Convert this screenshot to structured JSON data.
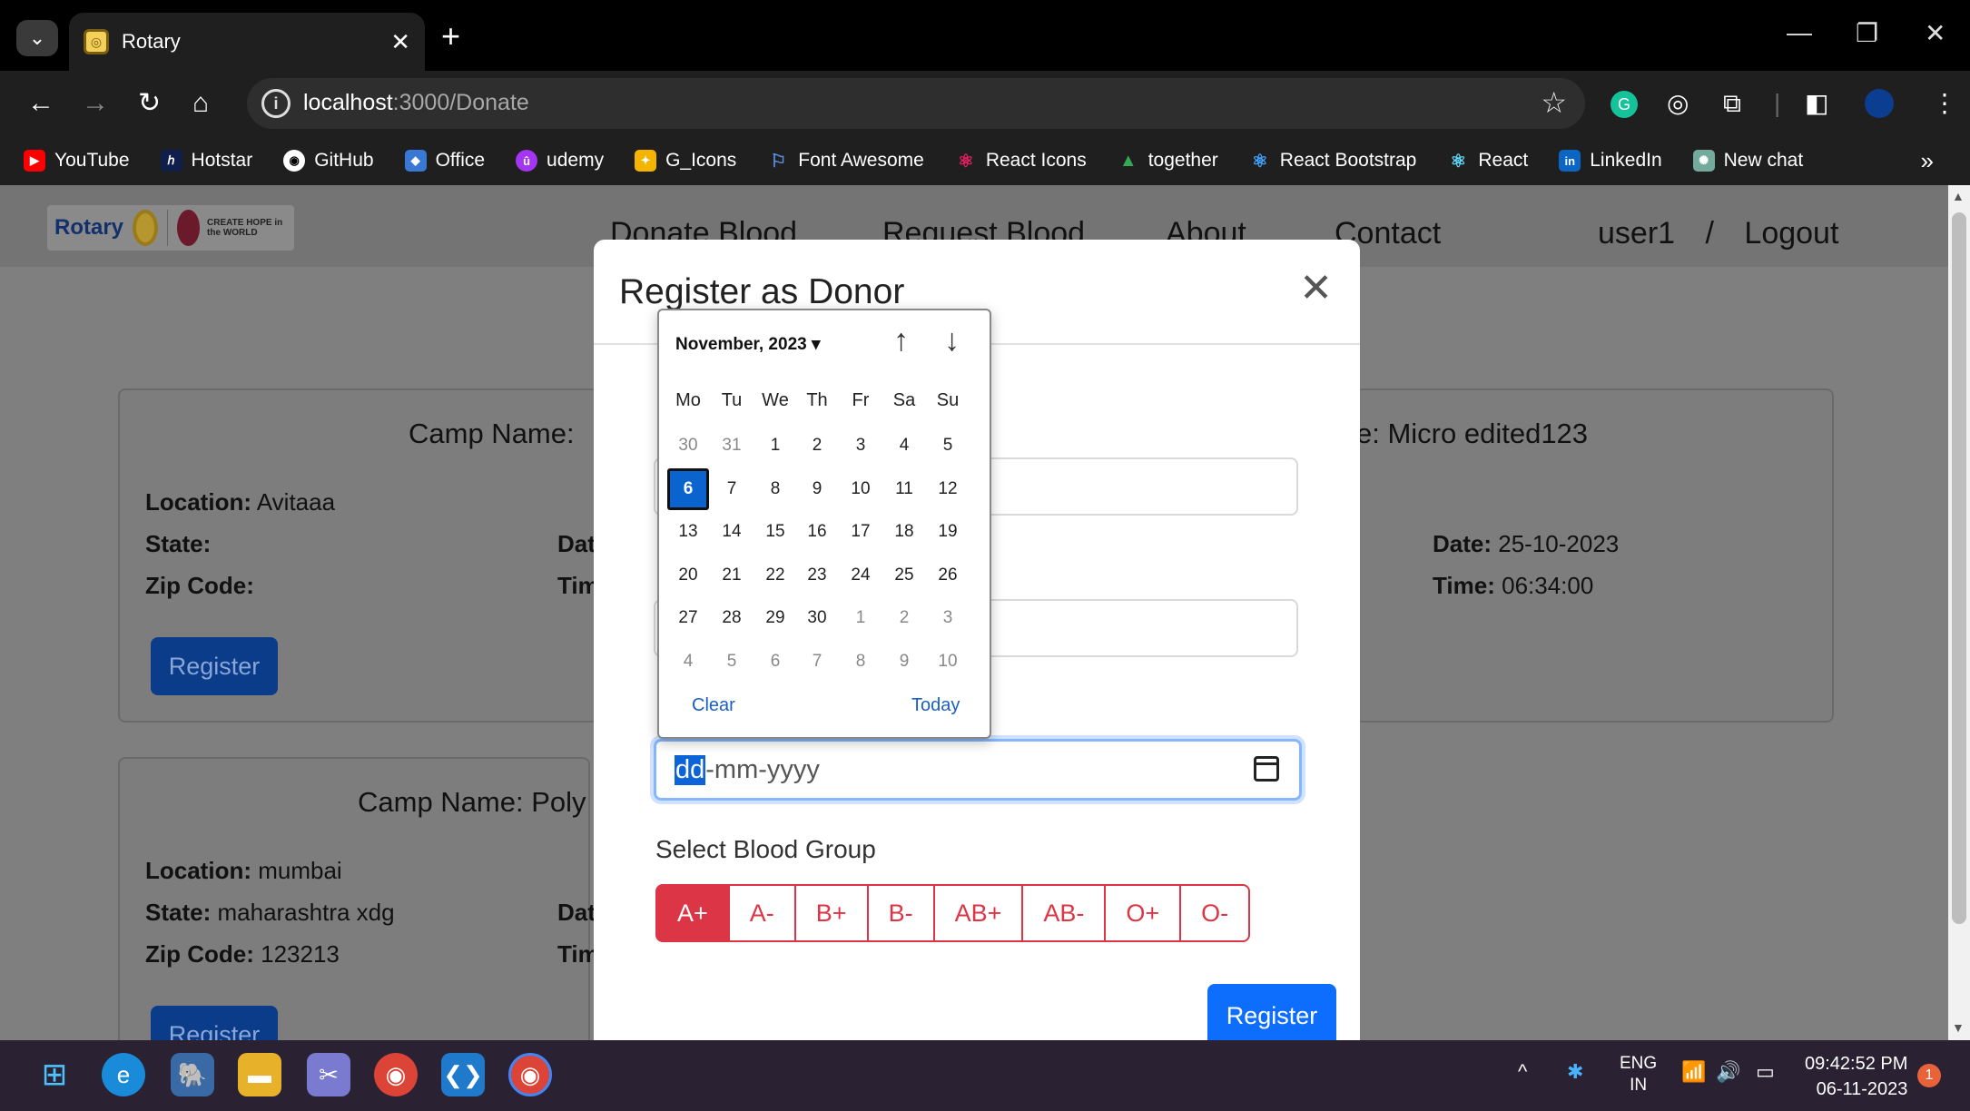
{
  "browser": {
    "tab_title": "Rotary",
    "tab_close": "✕",
    "new_tab": "+",
    "url_host": "localhost",
    "url_path": ":3000/Donate",
    "bookmarks": [
      "YouTube",
      "Hotstar",
      "GitHub",
      "Office",
      "udemy",
      "G_Icons",
      "Font Awesome",
      "React Icons",
      "together",
      "React Bootstrap",
      "React",
      "LinkedIn",
      "New chat"
    ],
    "bookmark_more": "»"
  },
  "navbar": {
    "logo_text": "Rotary",
    "logo_tagline": "CREATE HOPE in the WORLD",
    "links": [
      "Donate Blood",
      "Request Blood",
      "About",
      "Contact"
    ],
    "user": "user1",
    "separator": "/",
    "logout": "Logout"
  },
  "cards": [
    {
      "camp_name": "Camp Name:",
      "location_label": "Location:",
      "location": "Avitaaa",
      "state_label": "State:",
      "state": "",
      "zip_label": "Zip Code:",
      "zip": "",
      "date_label": "Dat",
      "time_label": "Tim",
      "register": "Register"
    },
    {
      "camp_name_right": "e: Micro edited123",
      "date_label": "Date:",
      "date": "25-10-2023",
      "time_label": "Time:",
      "time": "06:34:00"
    },
    {
      "camp_name": "Camp Name: Poly",
      "location_label": "Location:",
      "location": "mumbai",
      "state_label": "State:",
      "state": "maharashtra xdg",
      "zip_label": "Zip Code:",
      "zip": "123213",
      "date_label": "Dat",
      "time_label": "Tim",
      "register": "Register"
    }
  ],
  "modal": {
    "title": "Register as Donor",
    "close": "✕",
    "date_placeholder_sel": "dd",
    "date_placeholder_rest": "-mm-yyyy",
    "blood_group_label": "Select Blood Group",
    "blood_groups": [
      "A+",
      "A-",
      "B+",
      "B-",
      "AB+",
      "AB-",
      "O+",
      "O-"
    ],
    "selected_blood_group": "A+",
    "register": "Register"
  },
  "datepicker": {
    "month": "November, 2023",
    "weekdays": [
      "Mo",
      "Tu",
      "We",
      "Th",
      "Fr",
      "Sa",
      "Su"
    ],
    "weeks": [
      [
        "30",
        "31",
        "1",
        "2",
        "3",
        "4",
        "5"
      ],
      [
        "6",
        "7",
        "8",
        "9",
        "10",
        "11",
        "12"
      ],
      [
        "13",
        "14",
        "15",
        "16",
        "17",
        "18",
        "19"
      ],
      [
        "20",
        "21",
        "22",
        "23",
        "24",
        "25",
        "26"
      ],
      [
        "27",
        "28",
        "29",
        "30",
        "1",
        "2",
        "3"
      ],
      [
        "4",
        "5",
        "6",
        "7",
        "8",
        "9",
        "10"
      ]
    ],
    "selected": "6",
    "clear": "Clear",
    "today": "Today"
  },
  "taskbar": {
    "lang": "ENG",
    "region": "IN",
    "time": "09:42:52 PM",
    "date": "06-11-2023",
    "notifications": "1"
  },
  "colors": {
    "primary": "#0d6efd",
    "danger": "#dc3545"
  }
}
